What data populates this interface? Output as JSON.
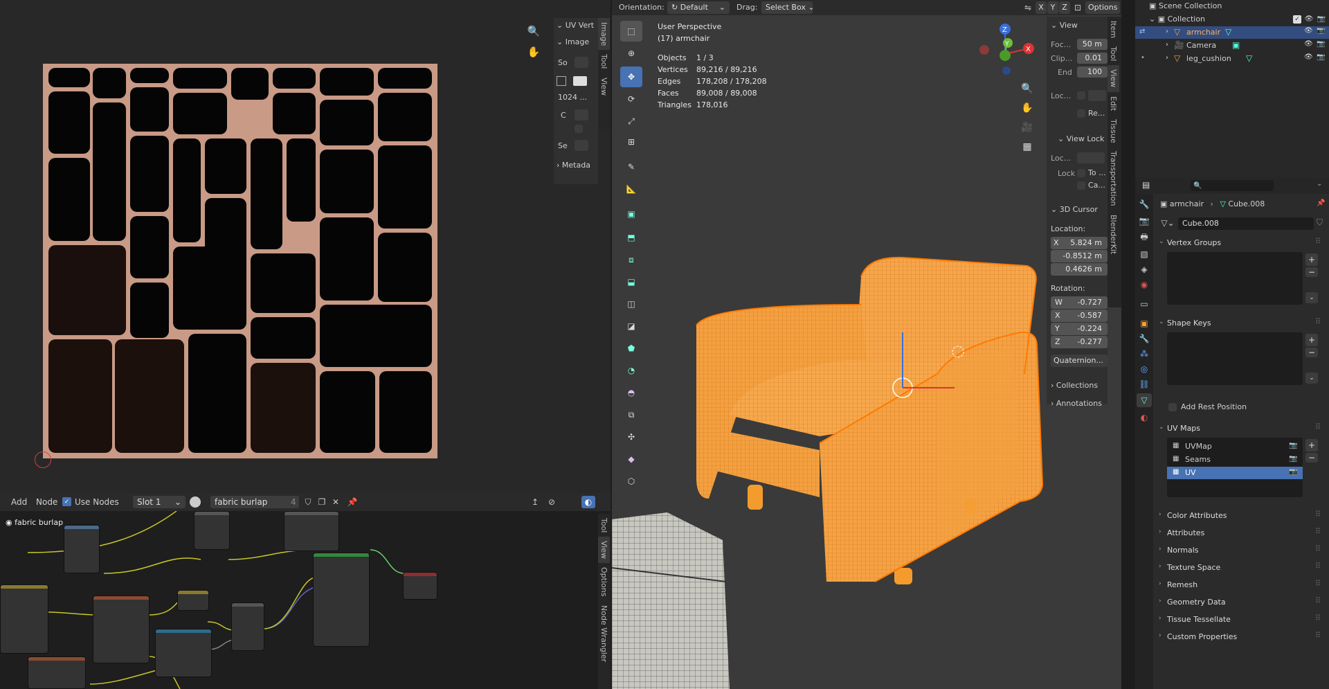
{
  "uv_editor": {
    "sidebar_tabs": [
      "Image",
      "Tool",
      "View"
    ],
    "panel_uv_vertex": "UV Vert",
    "panel_image": "Image",
    "field_so": "So",
    "field_res": "1024 ...",
    "field_c": "C",
    "field_se": "Se",
    "panel_metadata": "Metada"
  },
  "node_editor": {
    "menu_add": "Add",
    "menu_node": "Node",
    "use_nodes_label": "Use Nodes",
    "slot": "Slot 1",
    "material": "fabric burlap",
    "user_count": "4",
    "material_badge": "fabric burlap",
    "sidebar_tabs": [
      "Tool",
      "View",
      "Options",
      "Node Wrangler"
    ]
  },
  "viewport": {
    "header": {
      "orientation_label": "Orientation:",
      "orientation_value": "Default",
      "drag_label": "Drag:",
      "drag_value": "Select Box",
      "axes": [
        "X",
        "Y",
        "Z"
      ],
      "options": "Options"
    },
    "overlay": {
      "title": "User Perspective",
      "subtitle": "(17) armchair",
      "stats": [
        {
          "label": "Objects",
          "value": "1 / 3"
        },
        {
          "label": "Vertices",
          "value": "89,216 / 89,216"
        },
        {
          "label": "Edges",
          "value": "178,208 / 178,208"
        },
        {
          "label": "Faces",
          "value": "89,008 / 89,008"
        },
        {
          "label": "Triangles",
          "value": "178,016"
        }
      ]
    },
    "npanel": {
      "view_header": "View",
      "focal_label": "Foc...",
      "focal_value": "50 m",
      "clip_label": "Clip...",
      "clip_value": "0.01",
      "end_label": "End",
      "end_value": "100",
      "loc_label": "Loc...",
      "re_label": "Re...",
      "view_lock_header": "View Lock",
      "lock_loc_label": "Loc...",
      "lock_label": "Lock",
      "to_label": "To ...",
      "ca_label": "Ca...",
      "cursor_header": "3D Cursor",
      "location_label": "Location:",
      "loc_x": "5.824 m",
      "loc_y": "-0.8512 m",
      "loc_z": "0.4626 m",
      "rotation_label": "Rotation:",
      "rot_w": "-0.727",
      "rot_x": "-0.587",
      "rot_y": "-0.224",
      "rot_z": "-0.277",
      "rot_mode": "Quaternion...",
      "collections": "Collections",
      "annotations": "Annotations"
    },
    "side_tabs": [
      "Item",
      "Tool",
      "View",
      "Edit",
      "Tissue",
      "Transportation",
      "BlenderKit"
    ]
  },
  "outliner": {
    "root": "Scene Collection",
    "collection": "Collection",
    "items": [
      {
        "name": "armchair",
        "selected": true
      },
      {
        "name": "Camera",
        "selected": false
      },
      {
        "name": "leg_cushion",
        "selected": false
      }
    ]
  },
  "properties": {
    "search_placeholder": "",
    "breadcrumb_object": "armchair",
    "breadcrumb_mesh": "Cube.008",
    "mesh_name": "Cube.008",
    "sections": {
      "vertex_groups": "Vertex Groups",
      "shape_keys": "Shape Keys",
      "add_rest_position": "Add Rest Position",
      "uv_maps": "UV Maps",
      "color_attributes": "Color Attributes",
      "attributes": "Attributes",
      "normals": "Normals",
      "texture_space": "Texture Space",
      "remesh": "Remesh",
      "geometry_data": "Geometry Data",
      "tissue_tessellate": "Tissue Tessellate",
      "custom_properties": "Custom Properties"
    },
    "uv_maps": [
      {
        "name": "UVMap",
        "active": false
      },
      {
        "name": "Seams",
        "active": false
      },
      {
        "name": "UV",
        "active": true
      }
    ]
  },
  "colors": {
    "accent_blue": "#4772b3",
    "selection_orange": "#f7a133",
    "texture_copper": "#c99a86"
  }
}
